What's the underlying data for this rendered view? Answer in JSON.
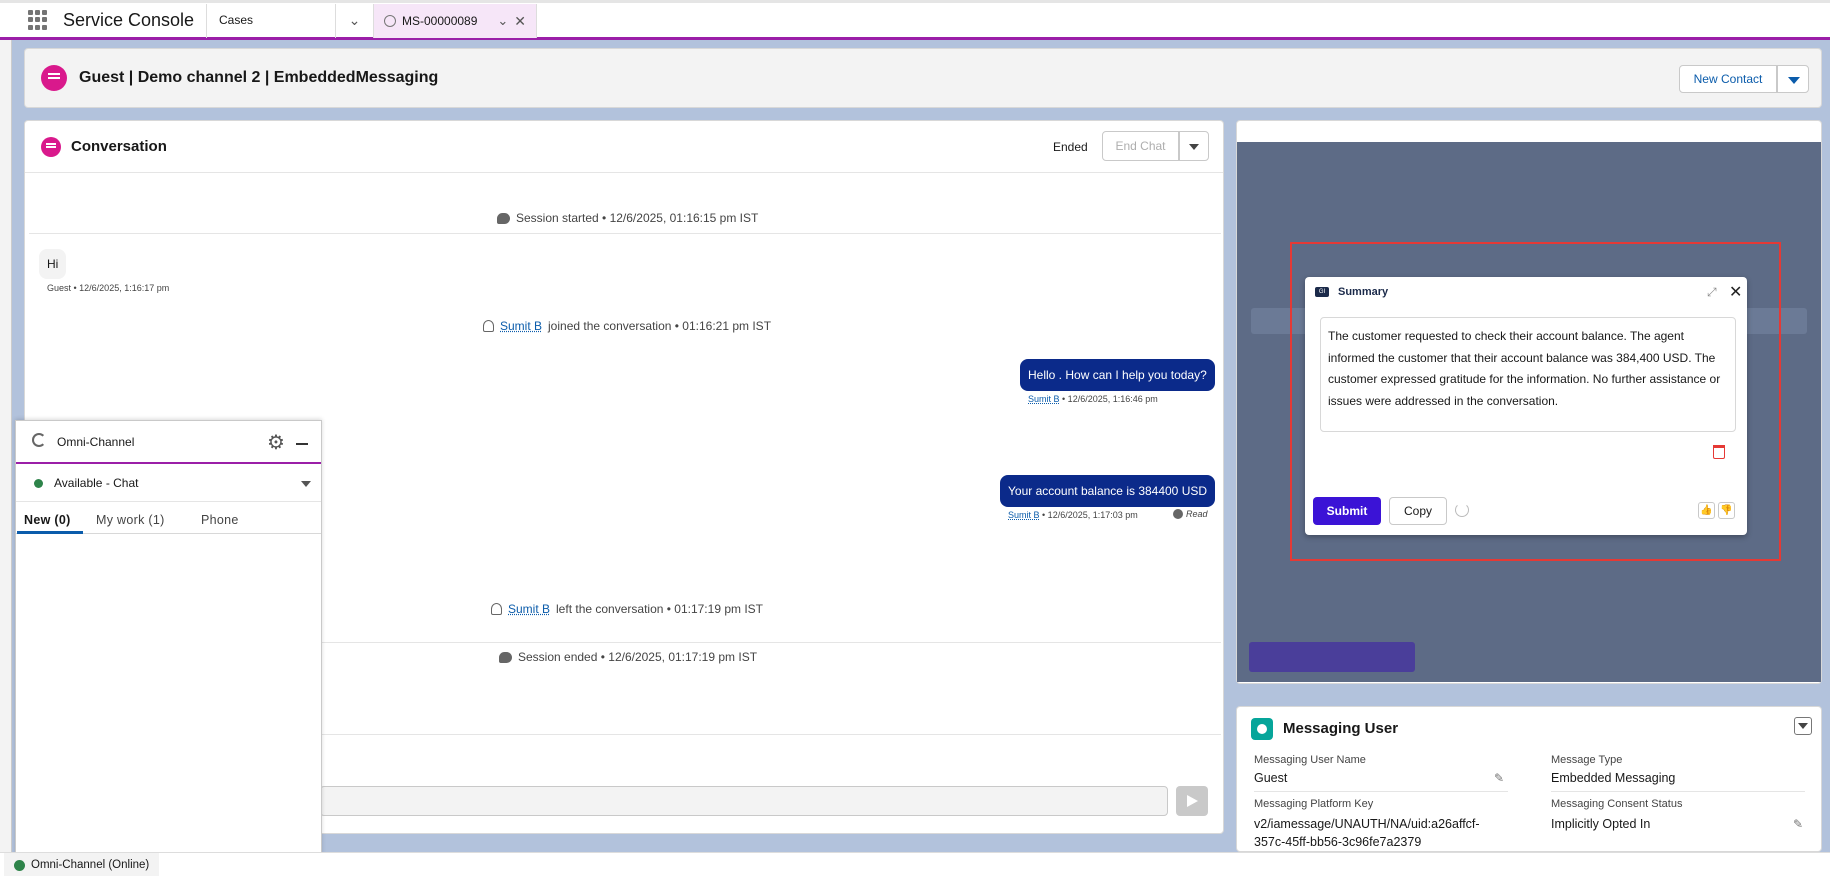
{
  "app": {
    "name": "Service Console"
  },
  "tabs": {
    "object_tab": "Cases",
    "record_tab": "MS-00000089"
  },
  "highlights": {
    "title": "Guest | Demo channel 2 | EmbeddedMessaging",
    "new_contact": "New Contact"
  },
  "conversation": {
    "title": "Conversation",
    "status": "Ended",
    "end_chat": "End Chat",
    "session_started": "Session started • 12/6/2025, 01:16:15 pm IST",
    "guest_msg": "Hi",
    "guest_meta": "Guest • 12/6/2025, 1:16:17 pm",
    "agent_name": "Sumit B",
    "joined_text": "joined the conversation • 01:16:21 pm IST",
    "agent_msg1": "Hello . How can I help you today?",
    "agent_meta1": "• 12/6/2025, 1:16:46 pm",
    "agent_msg2": "Your account balance is 384400 USD",
    "agent_meta2": "• 12/6/2025, 1:17:03 pm",
    "read_label": "Read",
    "left_text": "left the conversation • 01:17:19 pm IST",
    "session_ended": "Session ended • 12/6/2025, 01:17:19 pm IST"
  },
  "summary": {
    "icon_text": "GI",
    "title": "Summary",
    "text": "The customer requested to check their account balance. The agent informed the customer that their account balance was 384,400 USD. The customer expressed gratitude for the information. No further assistance or issues were addressed in the conversation.",
    "submit": "Submit",
    "copy": "Copy"
  },
  "messaging_user": {
    "title": "Messaging User",
    "fields": {
      "name_label": "Messaging User Name",
      "name_value": "Guest",
      "type_label": "Message Type",
      "type_value": "Embedded Messaging",
      "key_label": "Messaging Platform Key",
      "key_value": "v2/iamessage/UNAUTH/NA/uid:a26affcf-357c-45ff-bb56-3c96fe7a2379",
      "consent_label": "Messaging Consent Status",
      "consent_value": "Implicitly Opted In"
    }
  },
  "omni": {
    "title": "Omni-Channel",
    "status": "Available - Chat",
    "tabs": [
      "New (0)",
      "My work (1)",
      "Phone"
    ]
  },
  "utility": {
    "item": "Omni-Channel (Online)"
  },
  "colors": {
    "brand": "#9b1fa8",
    "accent": "#0b5cab",
    "agent_bubble": "#0b2a8a",
    "submit": "#3b13d6",
    "highlight": "#e53935"
  }
}
